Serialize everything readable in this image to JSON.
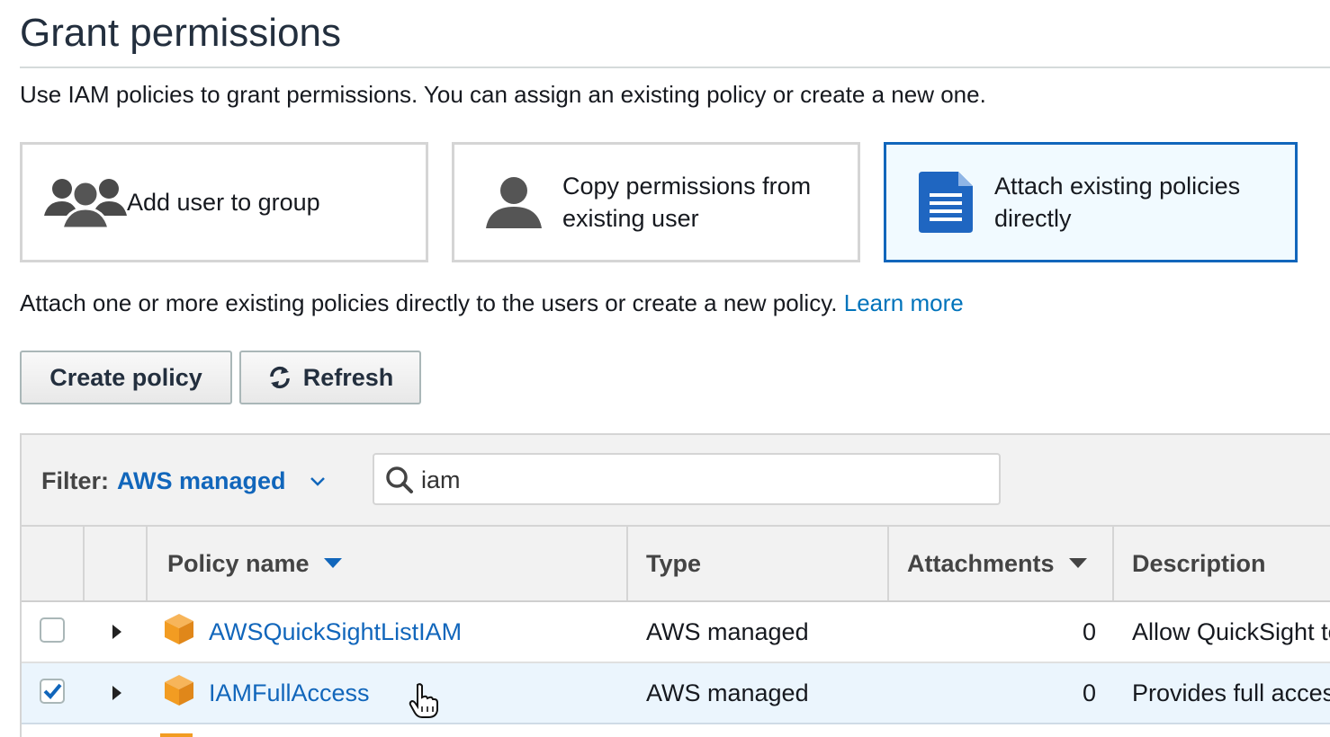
{
  "page": {
    "title": "Grant permissions",
    "intro": "Use IAM policies to grant permissions. You can assign an existing policy or create a new one."
  },
  "options": [
    {
      "label": "Add user to group",
      "icon": "users-group-icon",
      "selected": false
    },
    {
      "label": "Copy permissions from existing user",
      "icon": "user-icon",
      "selected": false
    },
    {
      "label": "Attach existing policies directly",
      "icon": "document-icon",
      "selected": true
    }
  ],
  "attach": {
    "text": "Attach one or more existing policies directly to the users or create a new policy.",
    "link": "Learn more"
  },
  "toolbar": {
    "create_label": "Create policy",
    "refresh_label": "Refresh"
  },
  "filter": {
    "label": "Filter:",
    "value": "AWS managed",
    "search_value": "iam"
  },
  "table": {
    "headers": {
      "policy_name": "Policy name",
      "type": "Type",
      "attachments": "Attachments",
      "description": "Description"
    },
    "rows": [
      {
        "name": "AWSQuickSightListIAM",
        "type": "AWS managed",
        "attachments": "0",
        "description": "Allow QuickSight to list IAM entities",
        "checked": false
      },
      {
        "name": "IAMFullAccess",
        "type": "AWS managed",
        "attachments": "0",
        "description": "Provides full access to IAM via the AWS Management Console.",
        "checked": true
      }
    ]
  },
  "colors": {
    "accent": "#1166bb",
    "link": "#0073bb",
    "selected_bg": "#f1faff",
    "row_selected_bg": "#ebf5fd",
    "policy_icon": "#f29c22"
  }
}
